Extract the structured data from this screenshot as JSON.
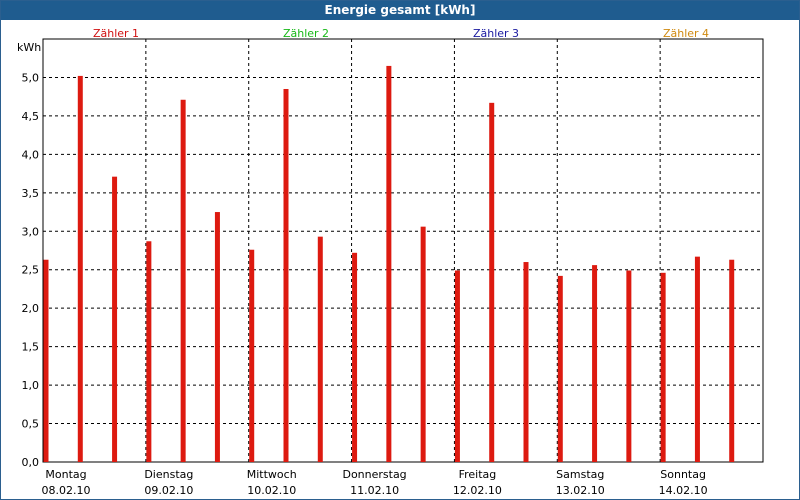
{
  "window": {
    "title": "Energie gesamt [kWh]"
  },
  "legend": [
    {
      "label": "Zähler 1",
      "color": "#d01010"
    },
    {
      "label": "Zähler 2",
      "color": "#18b818"
    },
    {
      "label": "Zähler 3",
      "color": "#1a1aa0"
    },
    {
      "label": "Zähler 4",
      "color": "#d08a10"
    }
  ],
  "chart_data": {
    "type": "bar",
    "ylabel": "kWh",
    "ylim": [
      0,
      5.5
    ],
    "ytick_labels": [
      "0,0",
      "0,5",
      "1,0",
      "1,5",
      "2,0",
      "2,5",
      "3,0",
      "3,5",
      "4,0",
      "4,5",
      "5,0"
    ],
    "days": [
      {
        "name": "Montag",
        "date": "08.02.10"
      },
      {
        "name": "Dienstag",
        "date": "09.02.10"
      },
      {
        "name": "Mittwoch",
        "date": "10.02.10"
      },
      {
        "name": "Donnerstag",
        "date": "11.02.10"
      },
      {
        "name": "Freitag",
        "date": "12.02.10"
      },
      {
        "name": "Samstag",
        "date": "13.02.10"
      },
      {
        "name": "Sonntag",
        "date": "14.02.10"
      }
    ],
    "bar_color": "#dd1a10",
    "values": [
      2.63,
      5.02,
      3.71,
      2.87,
      4.71,
      3.25,
      2.76,
      4.85,
      2.93,
      2.72,
      5.15,
      3.06,
      2.49,
      4.67,
      2.6,
      2.42,
      2.56,
      2.49,
      2.46,
      2.67,
      2.63
    ],
    "grid": true
  }
}
